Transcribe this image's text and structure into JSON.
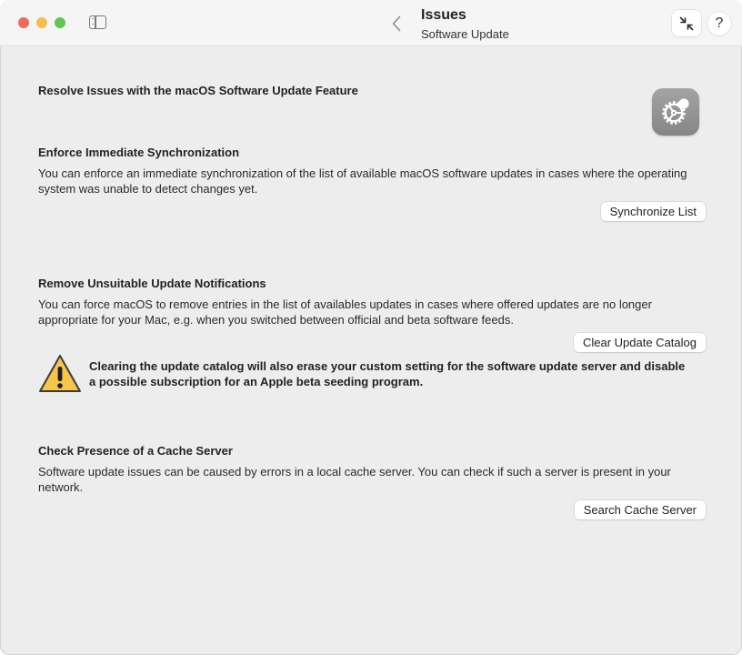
{
  "window": {
    "controls": {
      "close": "close-window",
      "minimize": "minimize-window",
      "zoom": "zoom-window"
    },
    "toolbar": {
      "sidebar_toggle_icon": "sidebar-left-icon",
      "back_icon": "chevron-left-icon",
      "title": "Issues",
      "subtitle": "Software Update",
      "collapse_icon": "arrows-collapse-icon",
      "help_label": "?"
    }
  },
  "main": {
    "title": "Resolve Issues with the macOS Software Update Feature",
    "app_icon": "software-update-gear-icon",
    "sections": [
      {
        "title": "Enforce Immediate Synchronization",
        "text": "You can enforce an immediate synchronization of the list of available macOS software updates in cases where the operating system was unable to detect changes yet.",
        "button_label": "Synchronize List"
      },
      {
        "title": "Remove Unsuitable Update Notifications",
        "text": "You can force macOS to remove entries in the list of availables updates in cases where offered updates are no longer appropriate for your Mac, e.g. when you switched between official and beta software feeds.",
        "button_label": "Clear Update Catalog",
        "warning_icon": "warning-triangle-icon",
        "warning_text": "Clearing the update catalog will also erase your custom setting for the software update server and disable a possible subscription for an Apple beta seeding program."
      },
      {
        "title": "Check Presence of a Cache Server",
        "text": "Software update issues can be caused by errors in a local cache server. You can check if such a server is present in your network.",
        "button_label": "Search Cache Server"
      }
    ]
  },
  "colors": {
    "close": "#ed6a5e",
    "minimize": "#f5bf4f",
    "zoom": "#61c554",
    "warning": "#f6c54a",
    "background": "#ededed",
    "titlebar": "#f5f5f5"
  }
}
